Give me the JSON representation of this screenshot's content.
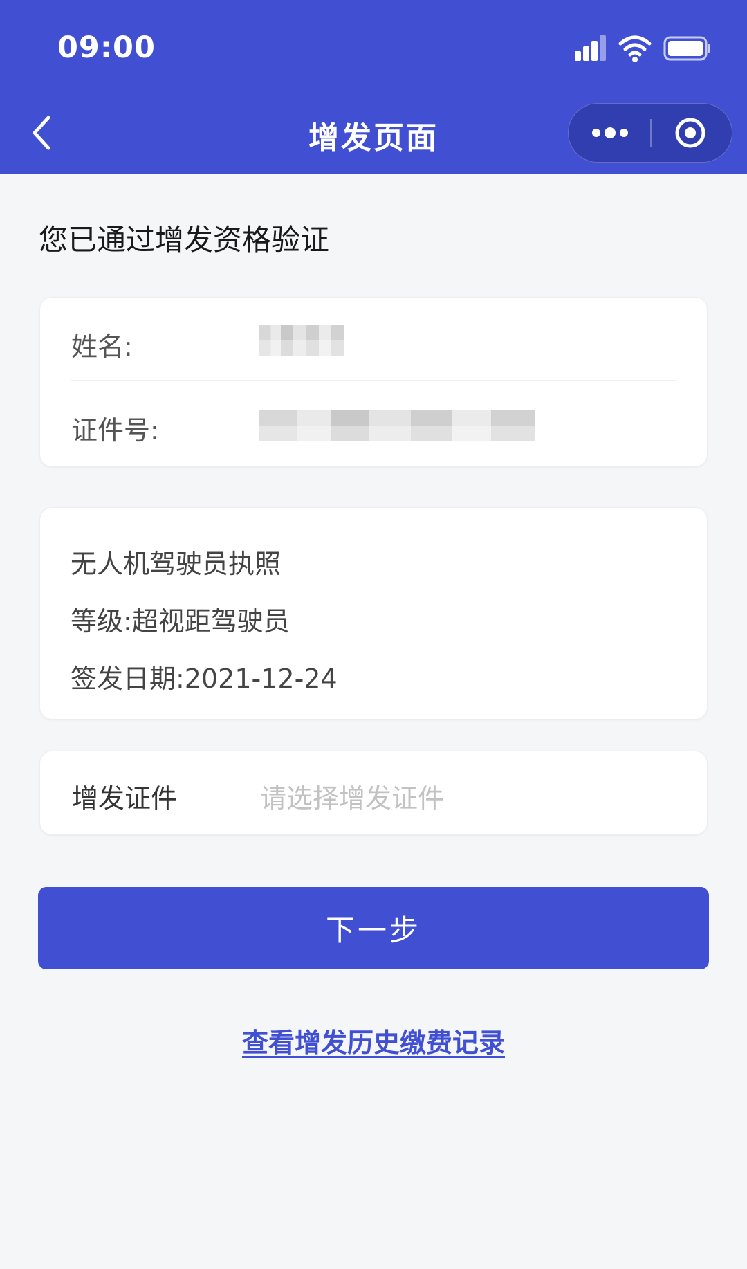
{
  "status_bar": {
    "time": "09:00",
    "icons": [
      "signal-icon",
      "wifi-icon",
      "battery-icon"
    ]
  },
  "nav": {
    "title": "增发页面",
    "back_icon": "chevron-left-icon",
    "capsule_icons": [
      "more-dots-icon",
      "close-target-icon"
    ]
  },
  "verify": {
    "title": "您已通过增发资格验证"
  },
  "identity": {
    "name_label": "姓名:",
    "id_label": "证件号:"
  },
  "license": {
    "name": "无人机驾驶员执照",
    "level": "等级:超视距驾驶员",
    "issue_date": "签发日期:2021-12-24"
  },
  "select": {
    "label": "增发证件",
    "placeholder": "请选择增发证件"
  },
  "actions": {
    "next_label": "下一步",
    "history_link": "查看增发历史缴费记录"
  },
  "colors": {
    "primary": "#4150d3",
    "background": "#f5f6f8",
    "card": "#ffffff",
    "placeholder": "#c2c2c2"
  }
}
